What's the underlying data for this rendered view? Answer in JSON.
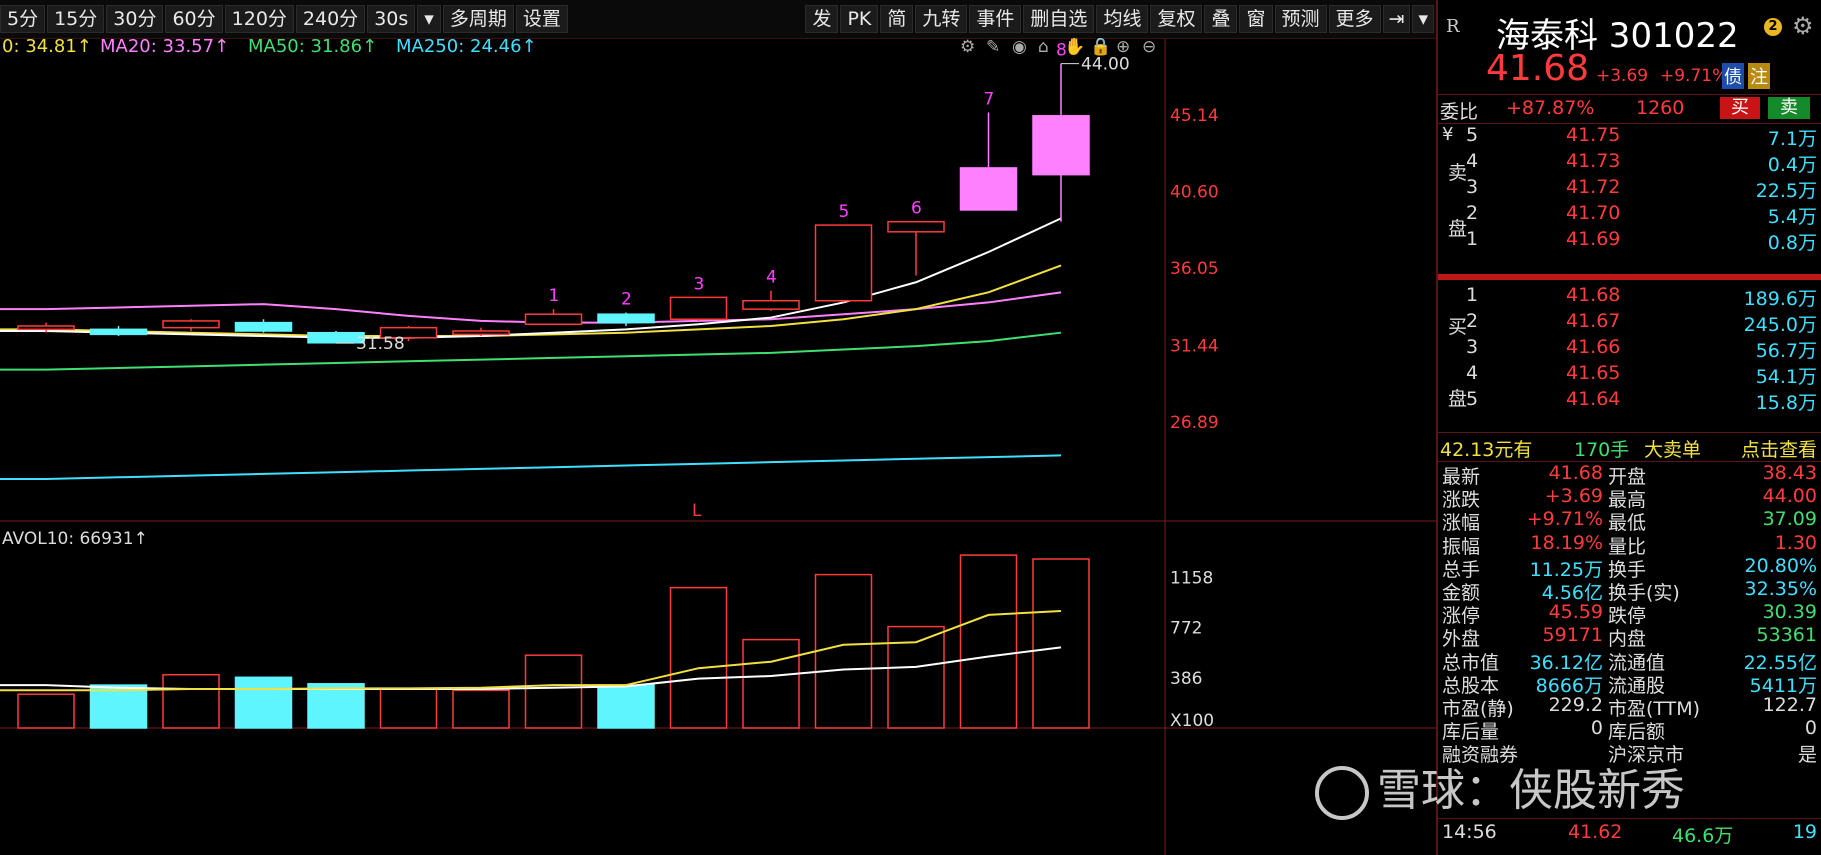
{
  "toolbar": {
    "left_buttons": [
      "5分",
      "15分",
      "30分",
      "60分",
      "120分",
      "240分",
      "30s"
    ],
    "multi_period": "多周期",
    "settings": "设置",
    "right_buttons": [
      "发",
      "PK",
      "简",
      "九转",
      "事件",
      "删自选",
      "均线",
      "复权",
      "叠",
      "窗",
      "预测",
      "更多"
    ]
  },
  "ma_legend": {
    "ma10": "0: 34.81↑",
    "ma20": "MA20: 33.57↑",
    "ma50": "MA50: 31.86↑",
    "ma250": "MA250: 24.46↑"
  },
  "vol_legend": "AVOL10: 66931↑",
  "price_axis": [
    "45.14",
    "40.60",
    "36.05",
    "31.44",
    "26.89"
  ],
  "vol_axis": [
    "1158",
    "772",
    "386",
    "X100"
  ],
  "annotations": {
    "high": "44.00",
    "low": "31.58",
    "marker": "L"
  },
  "chart_data": {
    "type": "candlestick",
    "candle_numbers": [
      "1",
      "2",
      "3",
      "4",
      "5",
      "6",
      "7",
      "8"
    ],
    "candles": [
      {
        "o": 32.6,
        "c": 32.4,
        "h": 32.8,
        "l": 32.2,
        "color": "red",
        "vol": 260
      },
      {
        "o": 32.4,
        "c": 32.1,
        "h": 32.6,
        "l": 32.0,
        "color": "cyan",
        "vol": 330
      },
      {
        "o": 32.5,
        "c": 32.9,
        "h": 33.0,
        "l": 32.3,
        "color": "red",
        "vol": 410
      },
      {
        "o": 32.8,
        "c": 32.3,
        "h": 33.0,
        "l": 32.2,
        "color": "cyan",
        "vol": 390
      },
      {
        "o": 32.2,
        "c": 31.6,
        "h": 32.3,
        "l": 31.58,
        "color": "cyan",
        "vol": 340
      },
      {
        "o": 31.9,
        "c": 32.5,
        "h": 32.6,
        "l": 31.7,
        "color": "red",
        "vol": 300
      },
      {
        "o": 32.1,
        "c": 32.3,
        "h": 32.5,
        "l": 32.0,
        "color": "red",
        "vol": 290
      },
      {
        "o": 32.7,
        "c": 33.3,
        "h": 33.6,
        "l": 32.7,
        "color": "red",
        "vol": 560
      },
      {
        "o": 33.3,
        "c": 32.8,
        "h": 33.4,
        "l": 32.6,
        "color": "cyan",
        "vol": 330
      },
      {
        "o": 33.0,
        "c": 34.3,
        "h": 34.3,
        "l": 32.9,
        "color": "red",
        "vol": 1080
      },
      {
        "o": 33.6,
        "c": 34.1,
        "h": 34.7,
        "l": 33.5,
        "color": "red",
        "vol": 680
      },
      {
        "o": 34.1,
        "c": 38.6,
        "h": 38.6,
        "l": 34.0,
        "color": "red",
        "vol": 1180
      },
      {
        "o": 38.2,
        "c": 38.8,
        "h": 38.8,
        "l": 35.6,
        "color": "red",
        "vol": 780
      },
      {
        "o": 39.5,
        "c": 42.0,
        "h": 45.3,
        "l": 39.5,
        "color": "magenta",
        "vol": 1330
      },
      {
        "o": 41.6,
        "c": 45.1,
        "h": 48.2,
        "l": 38.8,
        "color": "magenta",
        "vol": 1300
      }
    ],
    "ma_white": [
      32.3,
      32.2,
      32.1,
      32.0,
      31.9,
      31.9,
      32.0,
      32.2,
      32.4,
      32.7,
      33.1,
      34.0,
      35.2,
      37.0,
      39.0
    ],
    "ma_yellow": [
      32.4,
      32.3,
      32.2,
      32.1,
      32.0,
      32.0,
      32.0,
      32.1,
      32.2,
      32.4,
      32.6,
      33.0,
      33.6,
      34.6,
      36.2
    ],
    "ma_pink": [
      33.6,
      33.7,
      33.8,
      33.9,
      33.6,
      33.2,
      32.9,
      32.8,
      32.8,
      32.9,
      33.0,
      33.3,
      33.6,
      34.0,
      34.6
    ],
    "ma_green": [
      30.0,
      30.1,
      30.2,
      30.3,
      30.4,
      30.5,
      30.6,
      30.7,
      30.8,
      30.9,
      31.0,
      31.2,
      31.4,
      31.7,
      32.2
    ],
    "ma_cyan": [
      23.5,
      23.6,
      23.7,
      23.8,
      23.9,
      24.0,
      24.1,
      24.2,
      24.3,
      24.4,
      24.5,
      24.6,
      24.7,
      24.8,
      24.9
    ],
    "vol_yellow": [
      290,
      290,
      300,
      300,
      305,
      305,
      310,
      330,
      330,
      460,
      510,
      640,
      660,
      870,
      900
    ],
    "vol_white": [
      330,
      310,
      300,
      300,
      300,
      300,
      300,
      310,
      320,
      380,
      400,
      450,
      470,
      550,
      620
    ]
  },
  "quote": {
    "name": "海泰科 301022",
    "price": "41.68",
    "change": "+3.69",
    "pct": "+9.71%",
    "tag_bond": "债",
    "tag_note": "注",
    "rlogo": "R",
    "badge": "2",
    "weibi_label": "委比",
    "weibi_pct": "+87.87%",
    "weibi_val": "1260",
    "buy_btn": "买",
    "sell_btn": "卖"
  },
  "orderbook": {
    "sell_label": [
      "卖",
      "盘"
    ],
    "buy_label": [
      "买",
      "盘"
    ],
    "yen": "¥",
    "asks": [
      {
        "lv": "5",
        "p": "41.75",
        "v": "7.1万"
      },
      {
        "lv": "4",
        "p": "41.73",
        "v": "0.4万"
      },
      {
        "lv": "3",
        "p": "41.72",
        "v": "22.5万"
      },
      {
        "lv": "2",
        "p": "41.70",
        "v": "5.4万"
      },
      {
        "lv": "1",
        "p": "41.69",
        "v": "0.8万"
      }
    ],
    "bids": [
      {
        "lv": "1",
        "p": "41.68",
        "v": "189.6万"
      },
      {
        "lv": "2",
        "p": "41.67",
        "v": "245.0万"
      },
      {
        "lv": "3",
        "p": "41.66",
        "v": "56.7万"
      },
      {
        "lv": "4",
        "p": "41.65",
        "v": "54.1万"
      },
      {
        "lv": "5",
        "p": "41.64",
        "v": "15.8万"
      }
    ]
  },
  "big_order": {
    "price": "42.13元有",
    "qty": "170手",
    "label": "大卖单",
    "link": "点击查看"
  },
  "stats": [
    {
      "k1": "最新",
      "v1": "41.68",
      "c1": "#ff3b3b",
      "k2": "开盘",
      "v2": "38.43",
      "c2": "#ff3b3b"
    },
    {
      "k1": "涨跌",
      "v1": "+3.69",
      "c1": "#ff3b3b",
      "k2": "最高",
      "v2": "44.00",
      "c2": "#ff3b3b"
    },
    {
      "k1": "涨幅",
      "v1": "+9.71%",
      "c1": "#ff3b3b",
      "k2": "最低",
      "v2": "37.09",
      "c2": "#3fe070"
    },
    {
      "k1": "振幅",
      "v1": "18.19%",
      "c1": "#ff3b3b",
      "k2": "量比",
      "v2": "1.30",
      "c2": "#ff3b3b"
    },
    {
      "k1": "总手",
      "v1": "11.25万",
      "c1": "#3fe0ff",
      "k2": "换手",
      "v2": "20.80%",
      "c2": "#3fe0ff"
    },
    {
      "k1": "金额",
      "v1": "4.56亿",
      "c1": "#3fe0ff",
      "k2": "换手(实)",
      "v2": "32.35%",
      "c2": "#3fe0ff"
    },
    {
      "k1": "涨停",
      "v1": "45.59",
      "c1": "#ff3b3b",
      "k2": "跌停",
      "v2": "30.39",
      "c2": "#3fe070"
    },
    {
      "k1": "外盘",
      "v1": "59171",
      "c1": "#ff3b3b",
      "k2": "内盘",
      "v2": "53361",
      "c2": "#3fe070"
    },
    {
      "k1": "总市值",
      "v1": "36.12亿",
      "c1": "#3fe0ff",
      "k2": "流通值",
      "v2": "22.55亿",
      "c2": "#3fe0ff"
    },
    {
      "k1": "总股本",
      "v1": "8666万",
      "c1": "#3fe0ff",
      "k2": "流通股",
      "v2": "5411万",
      "c2": "#3fe0ff"
    },
    {
      "k1": "市盈(静)",
      "v1": "229.2",
      "c1": "#ddd",
      "k2": "市盈(TTM)",
      "v2": "122.7",
      "c2": "#ddd"
    },
    {
      "k1": "库后量",
      "v1": "0",
      "c1": "#ddd",
      "k2": "库后额",
      "v2": "0",
      "c2": "#ddd"
    },
    {
      "k1": "融资融券",
      "v1": "",
      "c1": "#ddd",
      "k2": "沪深京市",
      "v2": "是",
      "c2": "#ddd"
    }
  ],
  "tick": {
    "time": "14:56",
    "price": "41.62",
    "vol": "46.6万",
    "num": "19"
  },
  "watermark": "雪球：侠股新秀",
  "colors": {
    "up": "#ff3b3b",
    "down": "#3fe0ff",
    "magenta": "#ff80ff"
  }
}
